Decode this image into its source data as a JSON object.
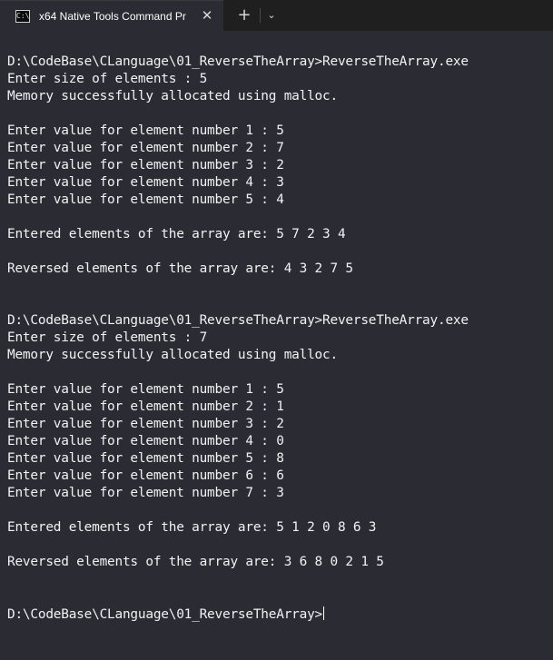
{
  "window": {
    "tab_title": "x64 Native Tools Command Pr",
    "icon_text": "C:\\",
    "close_glyph": "✕",
    "new_tab_glyph": "+",
    "dropdown_glyph": "⌄"
  },
  "console": {
    "lines": [
      "D:\\CodeBase\\CLanguage\\01_ReverseTheArray>ReverseTheArray.exe",
      "Enter size of elements : 5",
      "Memory successfully allocated using malloc.",
      "",
      "Enter value for element number 1 : 5",
      "Enter value for element number 2 : 7",
      "Enter value for element number 3 : 2",
      "Enter value for element number 4 : 3",
      "Enter value for element number 5 : 4",
      "",
      "Entered elements of the array are: 5 7 2 3 4",
      "",
      "Reversed elements of the array are: 4 3 2 7 5",
      "",
      "",
      "D:\\CodeBase\\CLanguage\\01_ReverseTheArray>ReverseTheArray.exe",
      "Enter size of elements : 7",
      "Memory successfully allocated using malloc.",
      "",
      "Enter value for element number 1 : 5",
      "Enter value for element number 2 : 1",
      "Enter value for element number 3 : 2",
      "Enter value for element number 4 : 0",
      "Enter value for element number 5 : 8",
      "Enter value for element number 6 : 6",
      "Enter value for element number 7 : 3",
      "",
      "Entered elements of the array are: 5 1 2 0 8 6 3",
      "",
      "Reversed elements of the array are: 3 6 8 0 2 1 5",
      "",
      ""
    ],
    "prompt": "D:\\CodeBase\\CLanguage\\01_ReverseTheArray>"
  },
  "colors": {
    "background": "#2b2b33",
    "text": "#f2f2f2",
    "titlebar": "#1f1f1f"
  }
}
